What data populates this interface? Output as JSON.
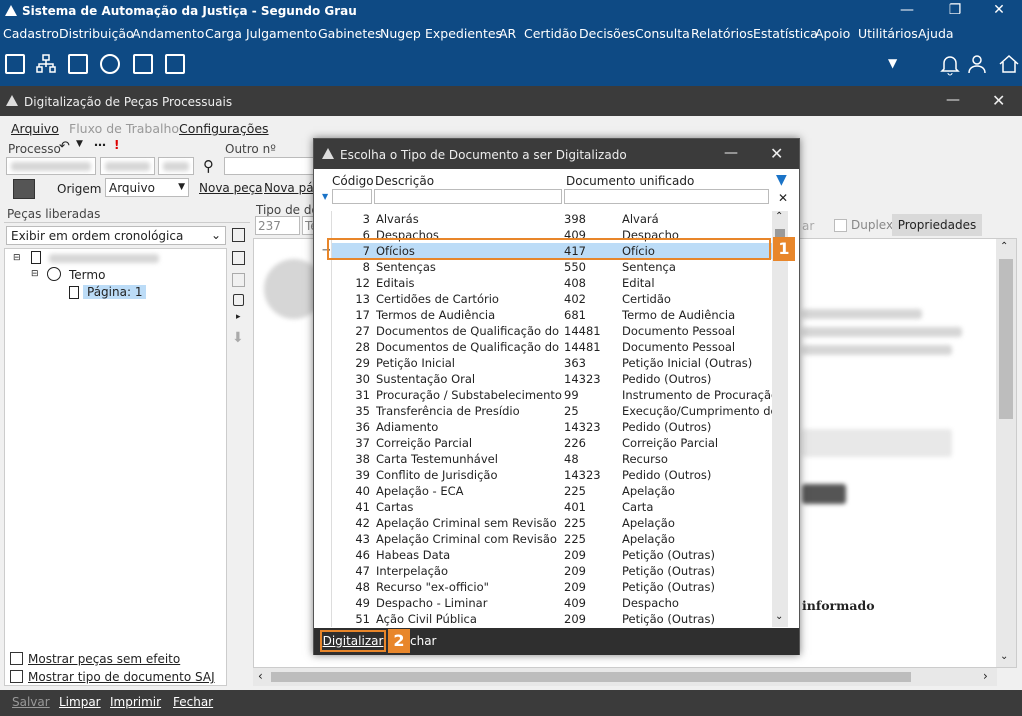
{
  "app": {
    "title": "Sistema de Automação da Justiça - Segundo Grau",
    "window_controls": [
      "minimize-icon",
      "restore-icon",
      "close-icon"
    ]
  },
  "menu": [
    "Cadastro",
    "Distribuição",
    "Andamento",
    "Carga",
    "Julgamento",
    "Gabinetes",
    "Nugep",
    "Expedientes",
    "AR",
    "Certidão",
    "Decisões",
    "Consulta",
    "Relatórios",
    "Estatística",
    "Apoio",
    "Utilitários",
    "Ajuda"
  ],
  "module": {
    "title": "Digitalização de Peças Processuais",
    "submenu": {
      "arquivo": "Arquivo",
      "fluxo": "Fluxo de Trabalho",
      "config": "Configurações"
    },
    "processo_label": "Processo",
    "outro_label": "Outro nº",
    "origem_label": "Origem",
    "origem_value": "Arquivo",
    "nova_peca": "Nova peça",
    "nova_pag": "Nova pág",
    "tipo_doc_label": "Tipo de doc",
    "tipo_doc_code": "237",
    "tipo_doc_desc": "Te",
    "pecas_label": "Peças liberadas",
    "ordem_value": "Exibir em ordem cronológica",
    "tree_termo": "Termo",
    "tree_pagina": "Página: 1",
    "duplex": "Duplex",
    "propriedades": "Propriedades",
    "ar_label": "ar",
    "informado": "informado",
    "mostrar_pecas": "Mostrar peças sem efeito",
    "mostrar_tipo": "Mostrar tipo de documento SAJ"
  },
  "dialog": {
    "title": "Escolha o Tipo de Documento a ser Digitalizado",
    "col_codigo": "Código",
    "col_descricao": "Descrição",
    "col_unificado": "Documento unificado",
    "rows": [
      [
        "3",
        "Alvarás",
        "398",
        "Alvará"
      ],
      [
        "6",
        "Despachos",
        "409",
        "Despacho"
      ],
      [
        "7",
        "Ofícios",
        "417",
        "Ofício"
      ],
      [
        "8",
        "Sentenças",
        "550",
        "Sentença"
      ],
      [
        "12",
        "Editais",
        "408",
        "Edital"
      ],
      [
        "13",
        "Certidões de Cartório",
        "402",
        "Certidão"
      ],
      [
        "17",
        "Termos de Audiência",
        "681",
        "Termo de Audiência"
      ],
      [
        "27",
        "Documentos de Qualificação do Auto",
        "14481",
        "Documento Pessoal"
      ],
      [
        "28",
        "Documentos de Qualificação do Réu",
        "14481",
        "Documento Pessoal"
      ],
      [
        "29",
        "Petição Inicial",
        "363",
        "Petição Inicial (Outras)"
      ],
      [
        "30",
        "Sustentação Oral",
        "14323",
        "Pedido (Outros)"
      ],
      [
        "31",
        "Procuração / Substabelecimento",
        "99",
        "Instrumento de Procuração"
      ],
      [
        "35",
        "Transferência de Presídio",
        "25",
        "Execução/Cumprimento de S"
      ],
      [
        "36",
        "Adiamento",
        "14323",
        "Pedido (Outros)"
      ],
      [
        "37",
        "Correição Parcial",
        "226",
        "Correição Parcial"
      ],
      [
        "38",
        "Carta Testemunhável",
        "48",
        "Recurso"
      ],
      [
        "39",
        "Conflito de Jurisdição",
        "14323",
        "Pedido (Outros)"
      ],
      [
        "40",
        "Apelação - ECA",
        "225",
        "Apelação"
      ],
      [
        "41",
        "Cartas",
        "401",
        "Carta"
      ],
      [
        "42",
        "Apelação Criminal sem Revisão",
        "225",
        "Apelação"
      ],
      [
        "43",
        "Apelação Criminal com Revisão",
        "225",
        "Apelação"
      ],
      [
        "46",
        "Habeas Data",
        "209",
        "Petição (Outras)"
      ],
      [
        "47",
        "Interpelação",
        "209",
        "Petição (Outras)"
      ],
      [
        "48",
        "Recurso \"ex-officio\"",
        "209",
        "Petição (Outras)"
      ],
      [
        "49",
        "Despacho - Liminar",
        "409",
        "Despacho"
      ],
      [
        "51",
        "Ação Civil Pública",
        "209",
        "Petição (Outras)"
      ]
    ],
    "selected_index": 2,
    "digitalizar": "Digitalizar",
    "fechar_partial": "char",
    "badge1": "1",
    "badge2": "2"
  },
  "bottom": {
    "salvar": "Salvar",
    "limpar": "Limpar",
    "imprimir": "Imprimir",
    "fechar": "Fechar"
  },
  "colors": {
    "titlebar": "#0e4a84",
    "dark": "#3b3b3b",
    "accent": "#e8862a",
    "selection": "#bcdcf7"
  }
}
